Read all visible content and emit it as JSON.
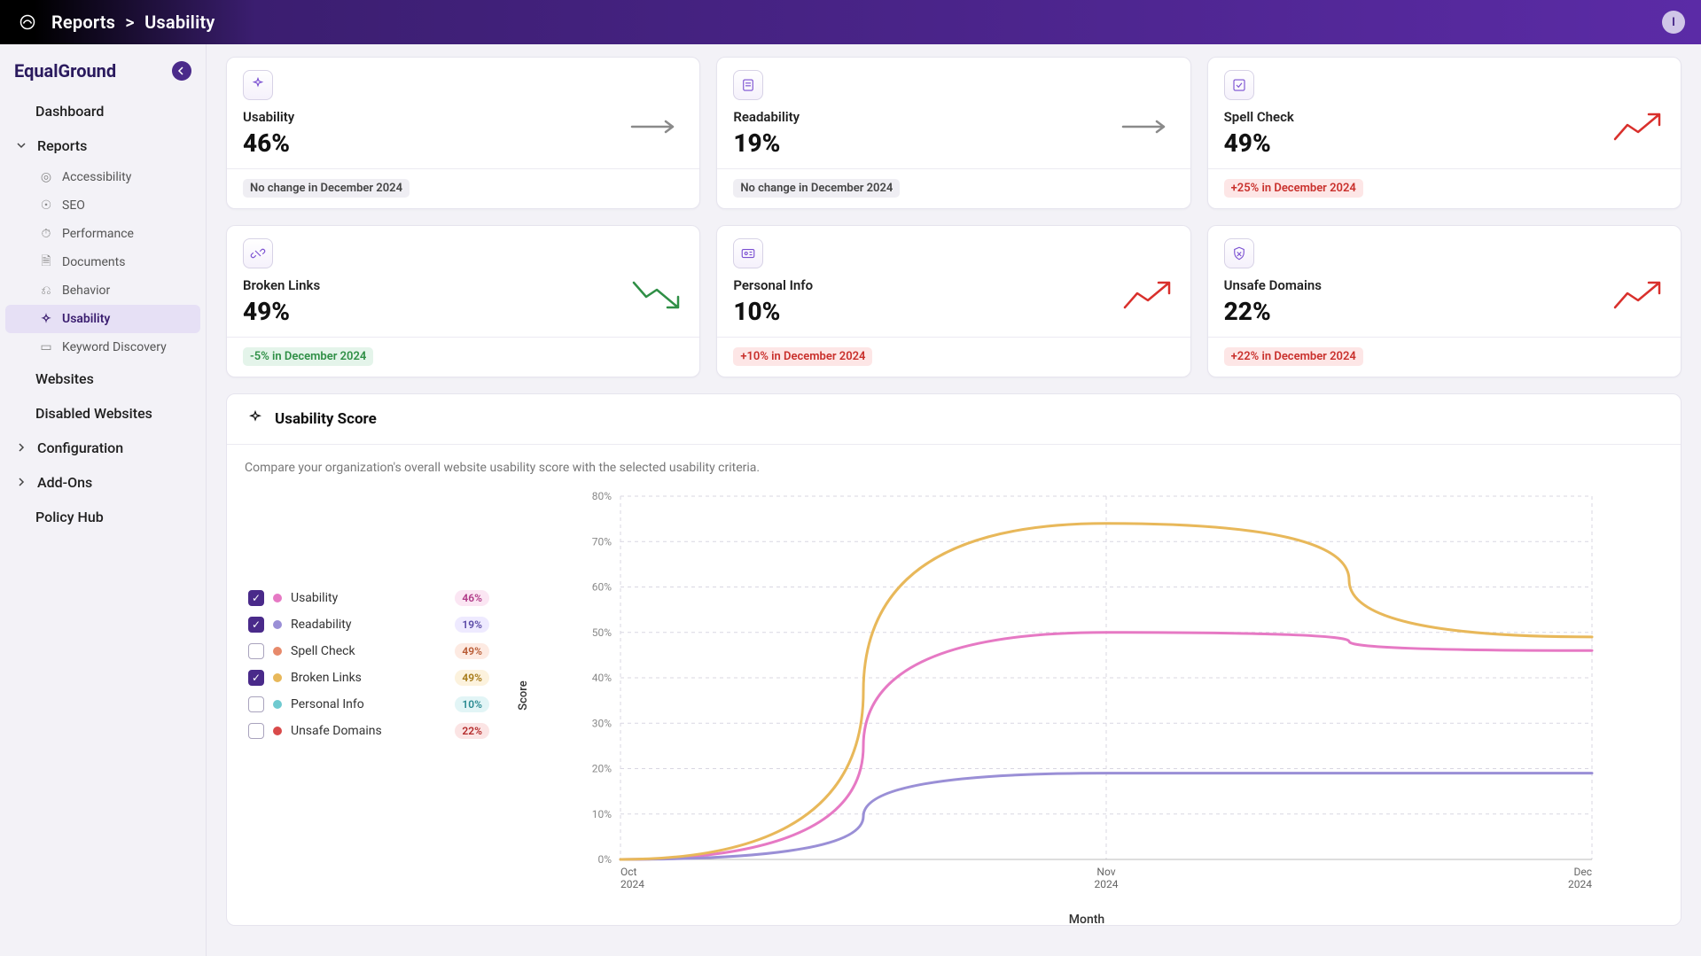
{
  "breadcrumb": {
    "a": "Reports",
    "sep": " > ",
    "b": "Usability"
  },
  "brand": "EqualGround",
  "user_initial": "I",
  "nav": {
    "dashboard": "Dashboard",
    "reports": "Reports",
    "reports_children": {
      "accessibility": "Accessibility",
      "seo": "SEO",
      "performance": "Performance",
      "documents": "Documents",
      "behavior": "Behavior",
      "usability": "Usability",
      "keyword": "Keyword Discovery"
    },
    "websites": "Websites",
    "disabled": "Disabled Websites",
    "configuration": "Configuration",
    "addons": "Add-Ons",
    "policy": "Policy Hub"
  },
  "cards": {
    "usability": {
      "title": "Usability",
      "pct": "46%",
      "delta": "No change in December 2024",
      "trend": "flat"
    },
    "readability": {
      "title": "Readability",
      "pct": "19%",
      "delta": "No change in December 2024",
      "trend": "flat"
    },
    "spell": {
      "title": "Spell Check",
      "pct": "49%",
      "delta": "+25% in December 2024",
      "trend": "up"
    },
    "broken": {
      "title": "Broken Links",
      "pct": "49%",
      "delta": "-5% in December 2024",
      "trend": "down"
    },
    "personal": {
      "title": "Personal Info",
      "pct": "10%",
      "delta": "+10% in December 2024",
      "trend": "up"
    },
    "unsafe": {
      "title": "Unsafe Domains",
      "pct": "22%",
      "delta": "+22% in December 2024",
      "trend": "up"
    }
  },
  "score": {
    "title": "Usability Score",
    "desc": "Compare your organization's overall website usability score with the selected usability criteria.",
    "ylabel": "Score",
    "xlabel": "Month",
    "legend": {
      "usability": {
        "label": "Usability",
        "pct": "46%",
        "checked": true,
        "color": "#e679c4"
      },
      "readability": {
        "label": "Readability",
        "pct": "19%",
        "checked": true,
        "color": "#9a8fd6"
      },
      "spell": {
        "label": "Spell Check",
        "pct": "49%",
        "checked": false,
        "color": "#e78a6b"
      },
      "broken": {
        "label": "Broken Links",
        "pct": "49%",
        "checked": true,
        "color": "#e8b85a"
      },
      "personal": {
        "label": "Personal Info",
        "pct": "10%",
        "checked": false,
        "color": "#6fcad0"
      },
      "unsafe": {
        "label": "Unsafe Domains",
        "pct": "22%",
        "checked": false,
        "color": "#d94a4a"
      }
    },
    "yticks": [
      "0%",
      "10%",
      "20%",
      "30%",
      "40%",
      "50%",
      "60%",
      "70%",
      "80%"
    ],
    "xticks": [
      {
        "a": "Oct",
        "b": "2024"
      },
      {
        "a": "Nov",
        "b": "2024"
      },
      {
        "a": "Dec",
        "b": "2024"
      }
    ]
  },
  "chart_data": {
    "type": "line",
    "xlabel": "Month",
    "ylabel": "Score",
    "ylim": [
      0,
      80
    ],
    "x": [
      "Oct 2024",
      "Nov 2024",
      "Dec 2024"
    ],
    "series": [
      {
        "name": "Usability",
        "color": "#e679c4",
        "values": [
          0,
          50,
          46
        ]
      },
      {
        "name": "Readability",
        "color": "#9a8fd6",
        "values": [
          0,
          19,
          19
        ]
      },
      {
        "name": "Broken Links",
        "color": "#e8b85a",
        "values": [
          0,
          74,
          49
        ]
      }
    ],
    "title": "Usability Score"
  }
}
